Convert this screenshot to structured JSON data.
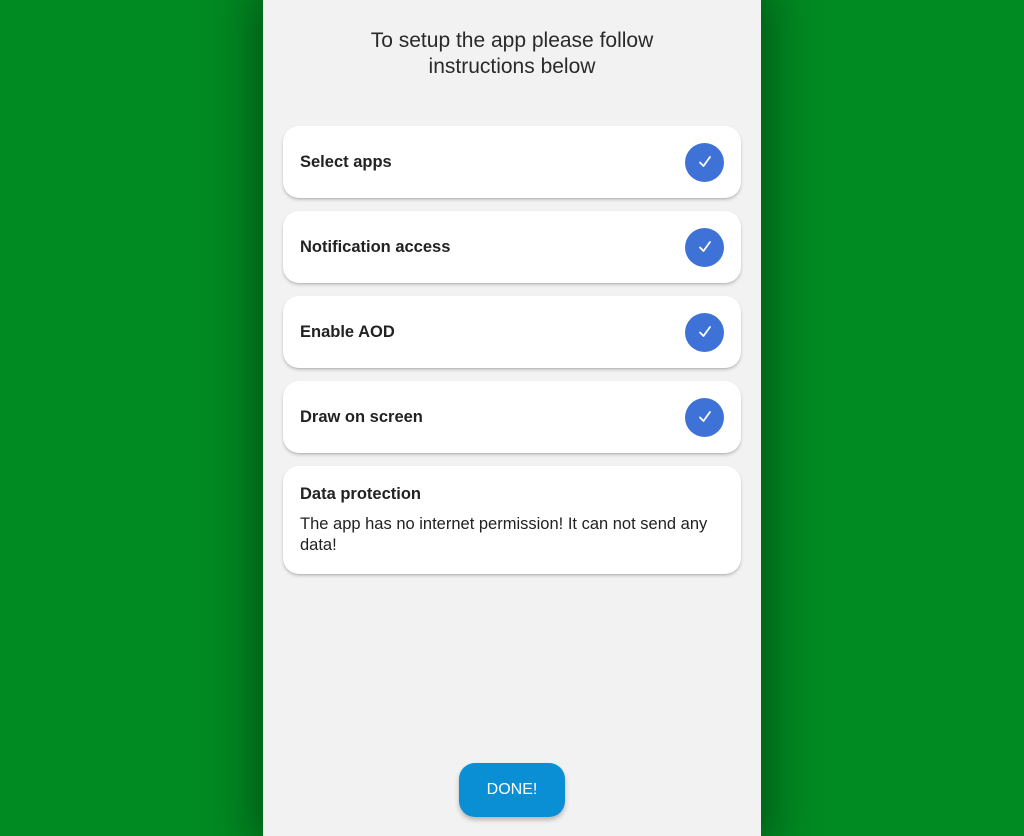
{
  "header": {
    "line1": "To setup the app please follow",
    "line2": "instructions below"
  },
  "steps": [
    {
      "label": "Select apps",
      "status": "completed",
      "icon": "checkmark-icon"
    },
    {
      "label": "Notification access",
      "status": "completed",
      "icon": "checkmark-icon"
    },
    {
      "label": "Enable AOD",
      "status": "completed",
      "icon": "checkmark-icon"
    },
    {
      "label": "Draw on screen",
      "status": "completed",
      "icon": "checkmark-icon"
    }
  ],
  "info": {
    "title": "Data protection",
    "text": "The app has no internet permission! It can not send any data!"
  },
  "done_button": {
    "label": "DONE!"
  },
  "colors": {
    "background": "#008a22",
    "panel": "#f2f2f2",
    "check": "#3f72d6",
    "button": "#0a8fd4"
  }
}
